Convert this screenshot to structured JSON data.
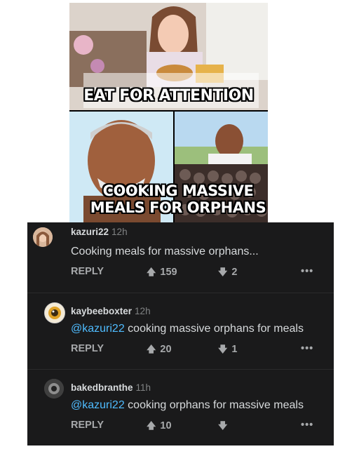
{
  "meme": {
    "caption_top": "EAT FOR ATTENTION",
    "caption_bottom": "COOKING MASSIVE MEALS FOR ORPHANS"
  },
  "comments": [
    {
      "username": "kazuri22",
      "age": "12h",
      "mention": "",
      "text": "Cooking meals for massive orphans...",
      "reply_label": "REPLY",
      "upvotes": "159",
      "downvotes": "2",
      "more": "•••"
    },
    {
      "username": "kaybeeboxter",
      "age": "12h",
      "mention": "@kazuri22",
      "text": " cooking massive orphans for meals",
      "reply_label": "REPLY",
      "upvotes": "20",
      "downvotes": "1",
      "more": "•••"
    },
    {
      "username": "bakedbranthe",
      "age": "11h",
      "mention": "@kazuri22",
      "text": " cooking orphans for massive meals",
      "reply_label": "REPLY",
      "upvotes": "10",
      "downvotes": "",
      "more": "•••"
    }
  ],
  "icons": {
    "upvote": "upvote-arrow-icon",
    "downvote": "downvote-arrow-icon",
    "more": "more-options-icon"
  },
  "colors": {
    "background": "#1a1a1b",
    "text": "#d7dadc",
    "mention": "#4fbcff",
    "muted": "#818384"
  }
}
